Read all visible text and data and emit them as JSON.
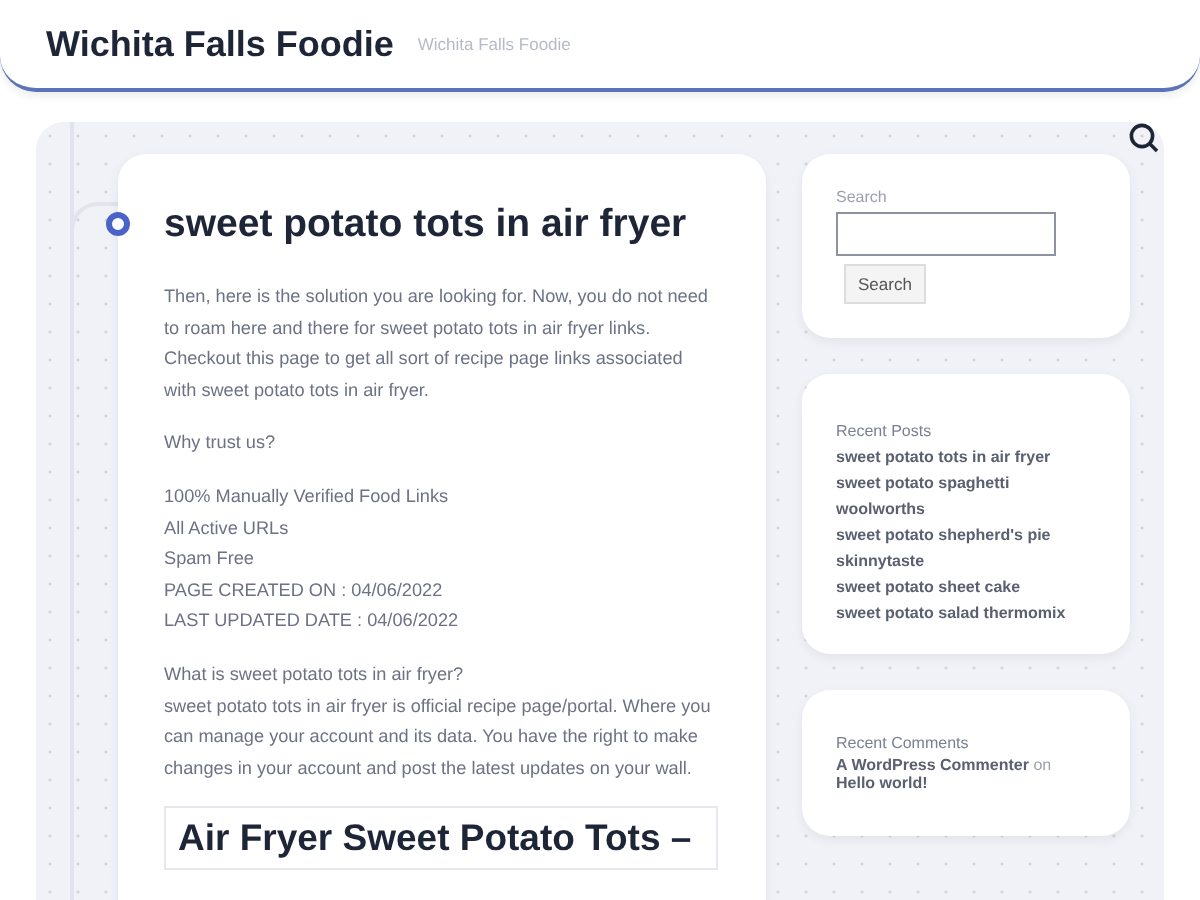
{
  "site": {
    "title": "Wichita Falls Foodie",
    "tagline": "Wichita Falls Foodie"
  },
  "post": {
    "title": "sweet potato tots in air fryer",
    "blocks": [
      {
        "kind": "para",
        "lines": [
          "Then, here is the solution you are looking for. Now, you do not need to roam here and there for sweet potato tots in air fryer links. Checkout this page to get all sort of recipe page links associated with sweet potato tots in air fryer."
        ]
      },
      {
        "kind": "para",
        "lines": [
          "Why trust us?"
        ]
      },
      {
        "kind": "para",
        "lines": [
          "100% Manually Verified Food Links",
          "All Active URLs",
          "Spam Free",
          "PAGE CREATED ON : 04/06/2022",
          "LAST UPDATED DATE : 04/06/2022"
        ]
      },
      {
        "kind": "para",
        "lines": [
          "What is sweet potato tots in air fryer?",
          "sweet potato tots in air fryer is official recipe page/portal. Where you can manage your account and its data. You have the right to make changes in your account and post the latest updates on your wall."
        ]
      },
      {
        "kind": "heading",
        "lines": [
          "Air Fryer Sweet Potato Tots –"
        ]
      }
    ]
  },
  "search_widget": {
    "label": "Search",
    "button": "Search"
  },
  "recent_posts": {
    "title": "Recent Posts",
    "items": [
      "sweet potato tots in air fryer",
      "sweet potato spaghetti woolworths",
      "sweet potato shepherd's pie skinnytaste",
      "sweet potato sheet cake",
      "sweet potato salad thermomix"
    ]
  },
  "recent_comments": {
    "title": "Recent Comments",
    "items": [
      {
        "author": "A WordPress Commenter",
        "on": "on",
        "post": "Hello world!"
      }
    ]
  }
}
